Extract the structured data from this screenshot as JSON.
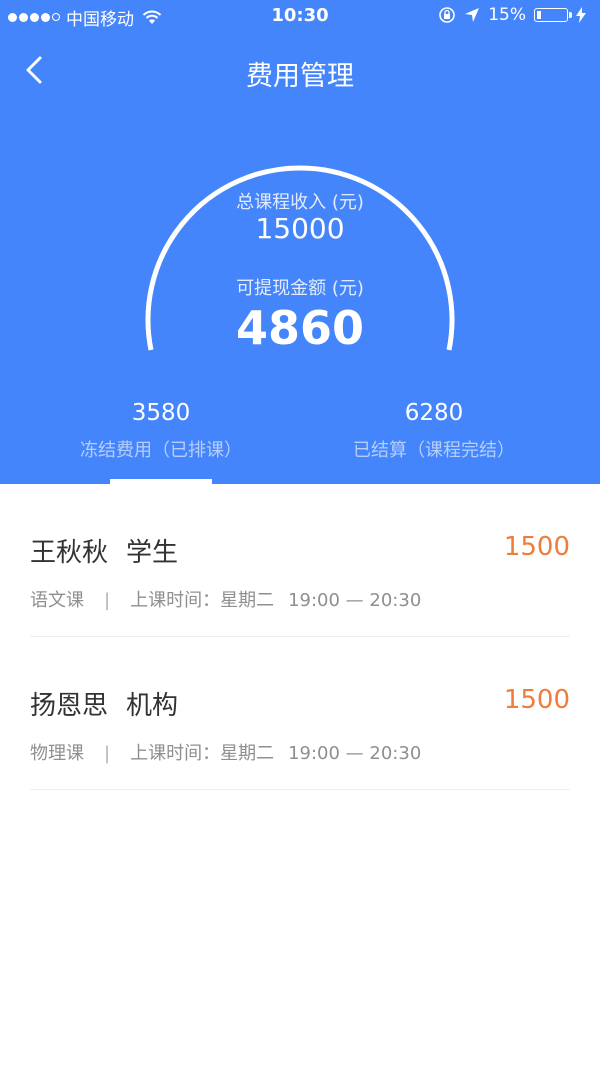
{
  "status_bar": {
    "carrier": "中国移动",
    "time": "10:30",
    "battery": "15%"
  },
  "nav": {
    "title": "费用管理",
    "back_icon": "chevron-left-icon"
  },
  "summary": {
    "total_label": "总课程收入 (元)",
    "total_value": "15000",
    "withdrawable_label": "可提现金额 (元)",
    "withdrawable_value": "4860"
  },
  "tabs": [
    {
      "value": "3580",
      "label": "冻结费用（已排课）"
    },
    {
      "value": "6280",
      "label": "已结算（课程完结）"
    }
  ],
  "active_tab": 0,
  "records": [
    {
      "name": "王秋秋",
      "role": "学生",
      "amount": "1500",
      "course": "语文课",
      "time_label": "上课时间：星期二",
      "time_range": "19:00 — 20:30"
    },
    {
      "name": "扬恩思",
      "role": "机构",
      "amount": "1500",
      "course": "物理课",
      "time_label": "上课时间：星期二",
      "time_range": "19:00 — 20:30"
    }
  ],
  "colors": {
    "header_blue": "#4585fb",
    "amount_orange": "#f07c3c"
  }
}
